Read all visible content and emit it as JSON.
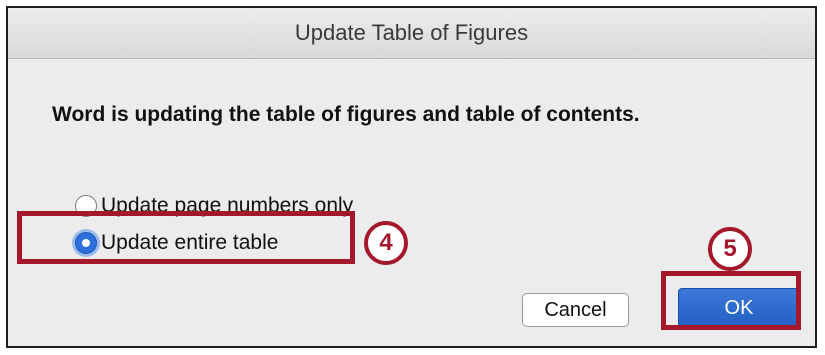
{
  "dialog": {
    "title": "Update Table of Figures",
    "message": "Word is updating the table of figures and table of contents.",
    "options": [
      {
        "label": "Update page numbers only",
        "selected": false
      },
      {
        "label": "Update entire table",
        "selected": true
      }
    ],
    "buttons": {
      "cancel_label": "Cancel",
      "ok_label": "OK"
    }
  },
  "annotations": {
    "step_radio": "4",
    "step_ok": "5",
    "highlight_color": "#a5172b"
  },
  "colors": {
    "accent": "#2f6fdc",
    "ok_button": "#2a66cc"
  }
}
